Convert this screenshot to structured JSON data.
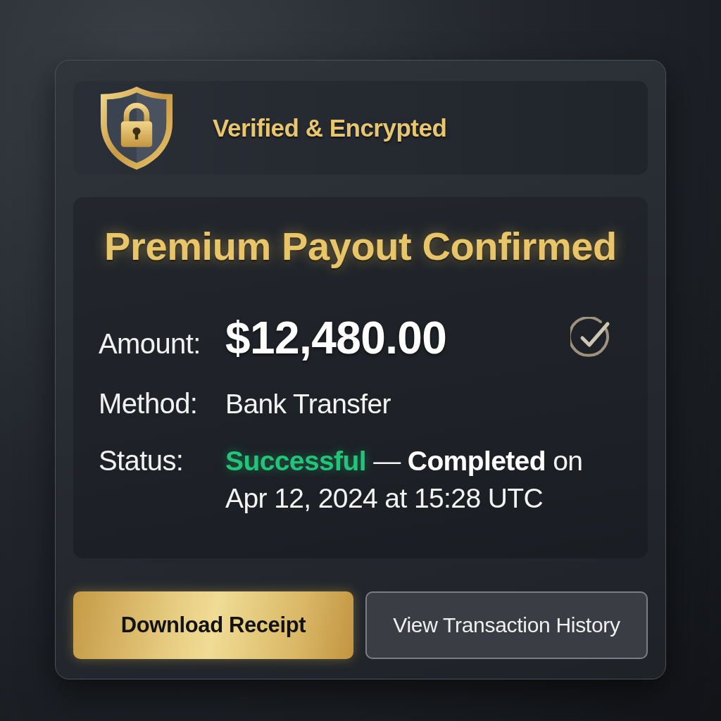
{
  "header": {
    "title": "Verified & Encrypted"
  },
  "payout": {
    "title": "Premium Payout Confirmed",
    "details": [
      {
        "kind": "amount",
        "label": "Amount:",
        "value": "$12,480.00"
      },
      {
        "kind": "text",
        "label": "Method:",
        "value": "Bank Transfer"
      },
      {
        "kind": "status",
        "label": "Status:",
        "value": "**Successful** — **Completed** on Apr 12, 2024 at 15:28 UTC"
      }
    ]
  },
  "buttons": [
    {
      "kind": "primary",
      "label": "Download Receipt"
    },
    {
      "kind": "secondary",
      "label": "View Transaction History"
    }
  ]
}
